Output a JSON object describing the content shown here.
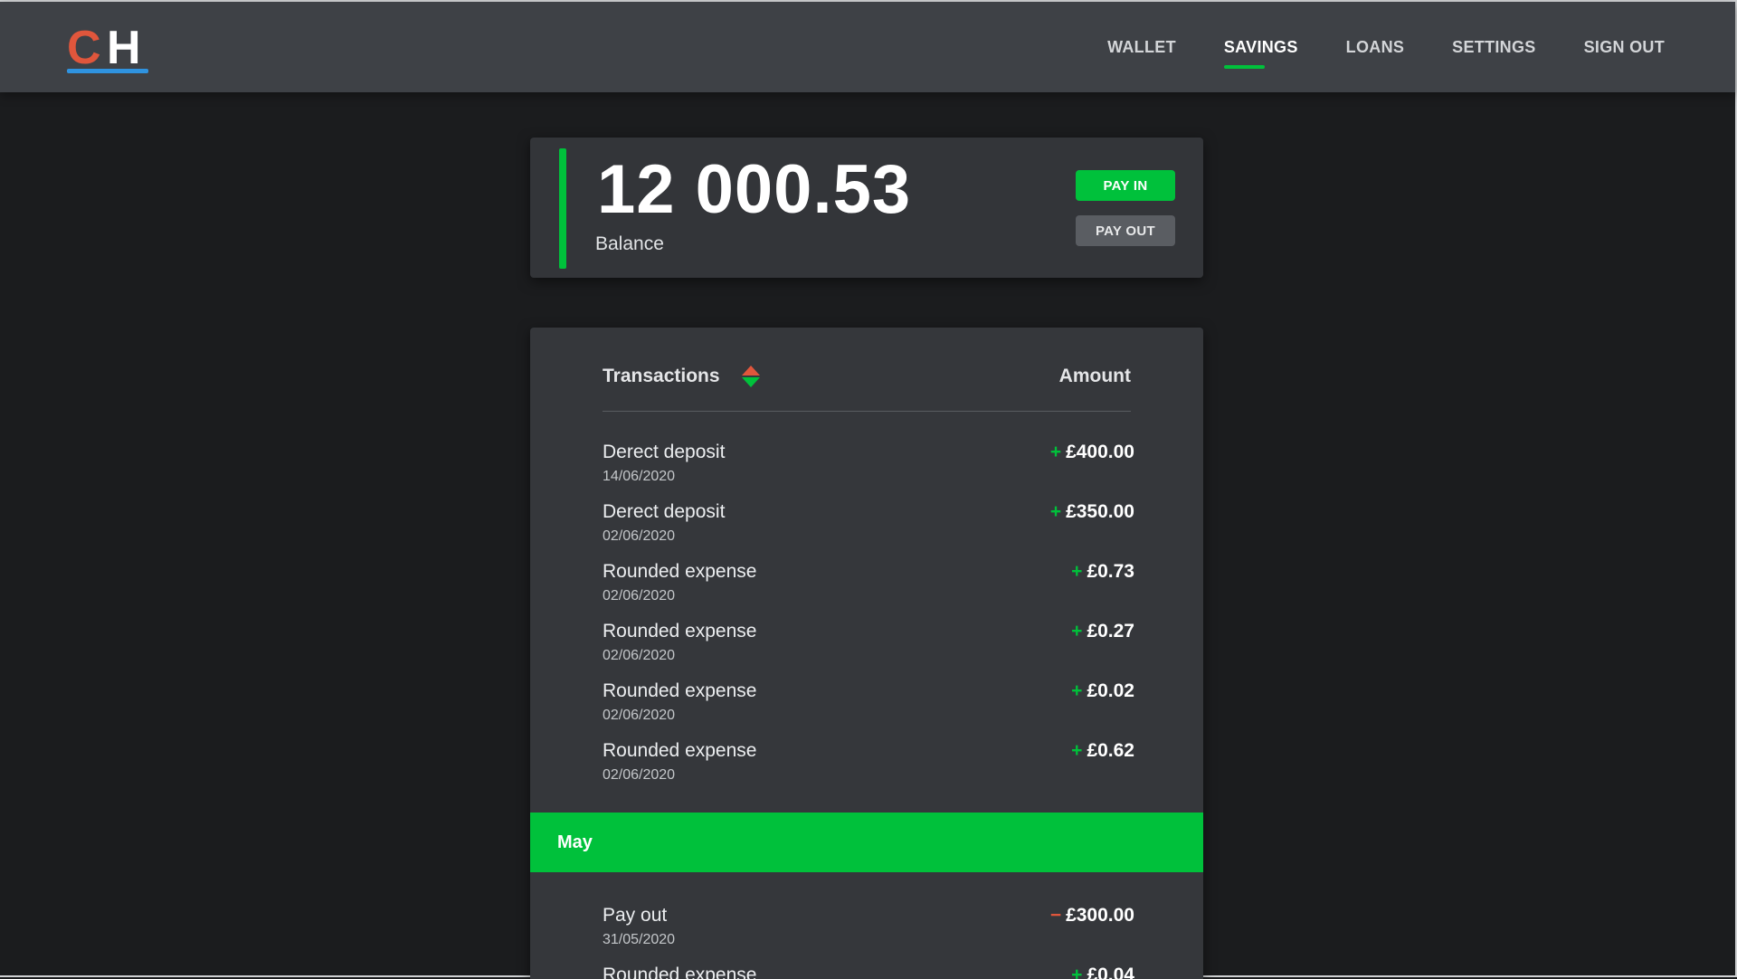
{
  "app": {
    "logo_letters": [
      "C",
      "H"
    ]
  },
  "nav": {
    "items": [
      {
        "label": "WALLET",
        "active": false
      },
      {
        "label": "SAVINGS",
        "active": true
      },
      {
        "label": "LOANS",
        "active": false
      },
      {
        "label": "SETTINGS",
        "active": false
      },
      {
        "label": "SIGN OUT",
        "active": false
      }
    ]
  },
  "balance": {
    "amount": "12 000.53",
    "label": "Balance",
    "pay_in_label": "PAY IN",
    "pay_out_label": "PAY OUT"
  },
  "transactions": {
    "header_title": "Transactions",
    "header_amount": "Amount",
    "rows": [
      {
        "name": "Derect deposit",
        "date": "14/06/2020",
        "sign": "+",
        "amount": "£400.00"
      },
      {
        "name": "Derect deposit",
        "date": "02/06/2020",
        "sign": "+",
        "amount": "£350.00"
      },
      {
        "name": "Rounded expense",
        "date": "02/06/2020",
        "sign": "+",
        "amount": "£0.73"
      },
      {
        "name": "Rounded expense",
        "date": "02/06/2020",
        "sign": "+",
        "amount": "£0.27"
      },
      {
        "name": "Rounded expense",
        "date": "02/06/2020",
        "sign": "+",
        "amount": "£0.02"
      },
      {
        "name": "Rounded expense",
        "date": "02/06/2020",
        "sign": "+",
        "amount": "£0.62"
      }
    ],
    "month_group": {
      "label": "May",
      "rows": [
        {
          "name": "Pay out",
          "date": "31/05/2020",
          "sign": "−",
          "amount": "£300.00"
        },
        {
          "name": "Rounded expense",
          "date": "",
          "sign": "+",
          "amount": "£0.04"
        }
      ]
    }
  },
  "colors": {
    "accent_green": "#00c13b",
    "negative_red": "#e0563c",
    "logo_blue": "#2f93e0",
    "header_bg": "#3e4146",
    "page_bg": "#1b1c1e",
    "card_bg": "#35373b"
  },
  "icons": {
    "sort": "sort-up-down-icon"
  }
}
